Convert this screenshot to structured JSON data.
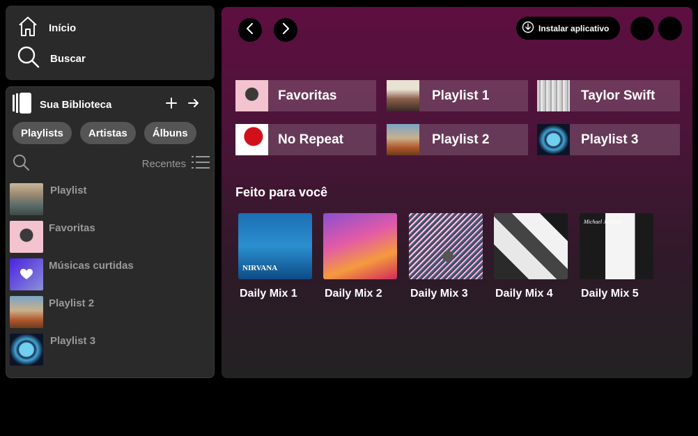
{
  "nav": {
    "home_label": "Início",
    "search_label": "Buscar"
  },
  "library": {
    "title": "Sua Biblioteca",
    "filters": [
      "Playlists",
      "Artistas",
      "Álbuns"
    ],
    "sort_label": "Recentes",
    "items": [
      {
        "name": "Playlist",
        "icon": "album-art-norman-icon"
      },
      {
        "name": "Favoritas",
        "icon": "album-art-pink-icon"
      },
      {
        "name": "Músicas curtidas",
        "icon": "heart-icon"
      },
      {
        "name": "Playlist 2",
        "icon": "album-art-astroworld-icon"
      },
      {
        "name": "Playlist 3",
        "icon": "album-art-awaken-icon"
      }
    ]
  },
  "header": {
    "install_label": "Instalar aplicativo"
  },
  "quick_access": [
    {
      "label": "Favoritas"
    },
    {
      "label": "Playlist 1"
    },
    {
      "label": "Taylor Swift"
    },
    {
      "label": "No Repeat"
    },
    {
      "label": "Playlist 2"
    },
    {
      "label": "Playlist 3"
    }
  ],
  "made_for_you": {
    "title": "Feito para você",
    "mixes": [
      {
        "label": "Daily Mix 1",
        "cover_text": "NIRVANA"
      },
      {
        "label": "Daily Mix 2"
      },
      {
        "label": "Daily Mix 3"
      },
      {
        "label": "Daily Mix 4"
      },
      {
        "label": "Daily Mix 5",
        "cover_text": "Michael Jackson"
      }
    ]
  },
  "colors": {
    "accent_gradient_top": "#5e0f40",
    "panel": "#2a2a2a",
    "chip": "#555555",
    "muted_text": "#9a9a9a"
  }
}
